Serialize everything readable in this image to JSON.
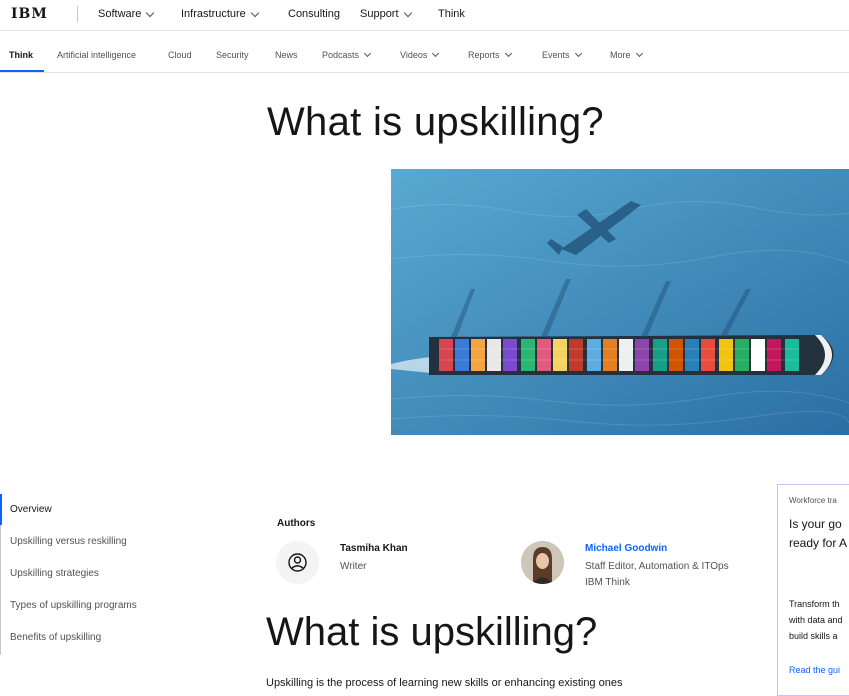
{
  "brand": {
    "logo_text": "IBM"
  },
  "topnav": {
    "items": [
      {
        "label": "Software",
        "has_dropdown": true
      },
      {
        "label": "Infrastructure",
        "has_dropdown": true
      },
      {
        "label": "Consulting",
        "has_dropdown": false
      },
      {
        "label": "Support",
        "has_dropdown": true
      },
      {
        "label": "Think",
        "has_dropdown": false
      }
    ]
  },
  "subnav": {
    "items": [
      {
        "label": "Think",
        "active": true
      },
      {
        "label": "Artificial intelligence"
      },
      {
        "label": "Cloud"
      },
      {
        "label": "Security"
      },
      {
        "label": "News"
      },
      {
        "label": "Podcasts",
        "has_dropdown": true
      },
      {
        "label": "Videos",
        "has_dropdown": true
      },
      {
        "label": "Reports",
        "has_dropdown": true
      },
      {
        "label": "Events",
        "has_dropdown": true
      },
      {
        "label": "More",
        "has_dropdown": true
      }
    ]
  },
  "hero": {
    "title": "What is upskilling?"
  },
  "toc": {
    "items": [
      {
        "label": "Overview",
        "active": true
      },
      {
        "label": "Upskilling versus reskilling"
      },
      {
        "label": "Upskilling strategies"
      },
      {
        "label": "Types of upskilling programs"
      },
      {
        "label": "Benefits of upskilling"
      }
    ]
  },
  "authors": {
    "label": "Authors",
    "list": [
      {
        "name": "Tasmiha Khan",
        "role": "Writer",
        "org": ""
      },
      {
        "name": "Michael Goodwin",
        "role": "Staff Editor, Automation & ITOps",
        "org": "IBM Think"
      }
    ]
  },
  "section": {
    "title": "What is upskilling?",
    "intro": "Upskilling is the process of learning new skills or enhancing existing ones"
  },
  "promo": {
    "kicker": "Workforce tra",
    "headline_1": "Is your go",
    "headline_2": "ready for A",
    "body_1": "Transform th",
    "body_2": "with data and",
    "body_3": "build skills a",
    "link": "Read the gui"
  },
  "colors": {
    "accent": "#0f62fe",
    "promo_border": "#d4bbff",
    "text": "#161616"
  }
}
